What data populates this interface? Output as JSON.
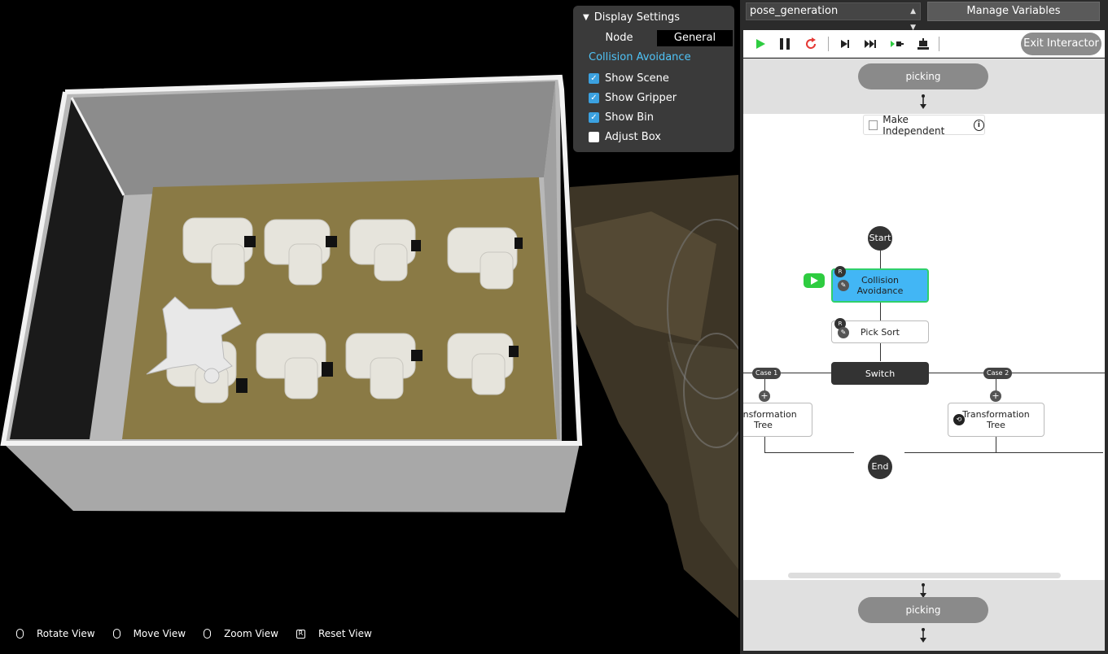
{
  "display_settings": {
    "title": "Display Settings",
    "tabs": [
      "Node",
      "General"
    ],
    "active_tab": "General",
    "section": "Collision Avoidance",
    "options": [
      {
        "label": "Show Scene",
        "checked": true
      },
      {
        "label": "Show Gripper",
        "checked": true
      },
      {
        "label": "Show Bin",
        "checked": true
      },
      {
        "label": "Adjust Box",
        "checked": false
      }
    ]
  },
  "view_controls": [
    {
      "label": "Rotate View",
      "icon": "mouse-left-icon"
    },
    {
      "label": "Move View",
      "icon": "mouse-right-icon"
    },
    {
      "label": "Zoom View",
      "icon": "mouse-wheel-icon"
    },
    {
      "label": "Reset View",
      "icon": "r-key-icon"
    }
  ],
  "header": {
    "select_value": "pose_generation",
    "manage_variables": "Manage Variables"
  },
  "toolbar": {
    "exit_label": "Exit Interactor",
    "icons": [
      "play-icon",
      "pause-icon",
      "restart-icon",
      "step-icon",
      "skip-icon",
      "run-to-icon",
      "robot-icon"
    ]
  },
  "flow": {
    "top_pill": "picking",
    "bottom_pill": "picking",
    "make_independent": "Make Independent",
    "info_glyph": "i",
    "start": "Start",
    "end": "End",
    "r_badge": "R",
    "plus_glyph": "+",
    "nodes": {
      "collision_line1": "Collision",
      "collision_line2": "Avoidance",
      "pick_sort": "Pick Sort",
      "switch": "Switch",
      "transform1_line1": "Transformation",
      "transform1_line2": "Tree",
      "transform2_line1": "Transformation",
      "transform2_line2": "Tree"
    },
    "cases": [
      "Case 1",
      "Case 2"
    ]
  },
  "colors": {
    "accent_blue": "#42b6f5",
    "active_green": "#2ecc40",
    "link_blue": "#4fc3f7"
  }
}
